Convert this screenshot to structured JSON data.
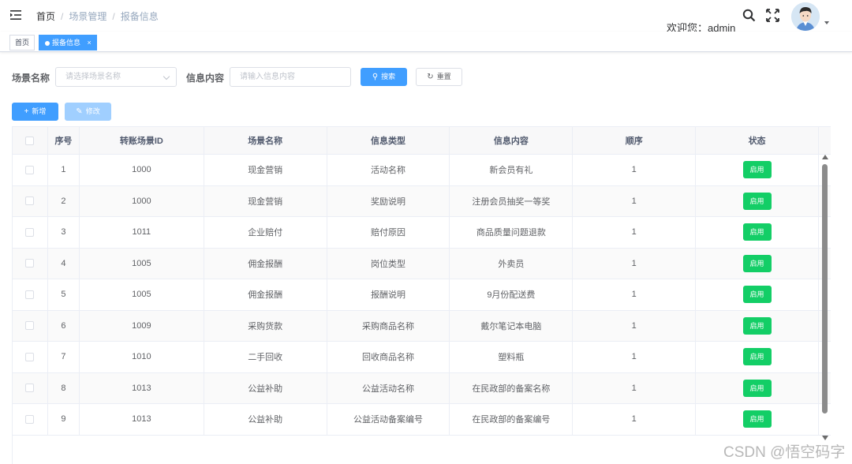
{
  "breadcrumb": [
    "首页",
    "场景管理",
    "报备信息"
  ],
  "user": {
    "welcome": "欢迎您：admin"
  },
  "tags": {
    "home": "首页",
    "active": "报备信息",
    "close": "×"
  },
  "form": {
    "scene_label": "场景名称",
    "scene_placeholder": "请选择场景名称",
    "info_label": "信息内容",
    "info_placeholder": "请输入信息内容",
    "search": "搜索",
    "reset": "重置"
  },
  "toolbar": {
    "add": "新增",
    "edit": "修改"
  },
  "table": {
    "headers": [
      "序号",
      "转账场景ID",
      "场景名称",
      "信息类型",
      "信息内容",
      "顺序",
      "状态"
    ],
    "rows": [
      {
        "no": "1",
        "scene_id": "1000",
        "scene": "现金营销",
        "type": "活动名称",
        "content": "新会员有礼",
        "order": "1",
        "status": "启用"
      },
      {
        "no": "2",
        "scene_id": "1000",
        "scene": "现金营销",
        "type": "奖励说明",
        "content": "注册会员抽奖一等奖",
        "order": "1",
        "status": "启用"
      },
      {
        "no": "3",
        "scene_id": "1011",
        "scene": "企业赔付",
        "type": "赔付原因",
        "content": "商品质量问题退款",
        "order": "1",
        "status": "启用"
      },
      {
        "no": "4",
        "scene_id": "1005",
        "scene": "佣金报酬",
        "type": "岗位类型",
        "content": "外卖员",
        "order": "1",
        "status": "启用"
      },
      {
        "no": "5",
        "scene_id": "1005",
        "scene": "佣金报酬",
        "type": "报酬说明",
        "content": "9月份配送费",
        "order": "1",
        "status": "启用"
      },
      {
        "no": "6",
        "scene_id": "1009",
        "scene": "采购货款",
        "type": "采购商品名称",
        "content": "戴尔笔记本电脑",
        "order": "1",
        "status": "启用"
      },
      {
        "no": "7",
        "scene_id": "1010",
        "scene": "二手回收",
        "type": "回收商品名称",
        "content": "塑料瓶",
        "order": "1",
        "status": "启用"
      },
      {
        "no": "8",
        "scene_id": "1013",
        "scene": "公益补助",
        "type": "公益活动名称",
        "content": "在民政部的备案名称",
        "order": "1",
        "status": "启用"
      },
      {
        "no": "9",
        "scene_id": "1013",
        "scene": "公益补助",
        "type": "公益活动备案编号",
        "content": "在民政部的备案编号",
        "order": "1",
        "status": "启用"
      }
    ]
  },
  "watermark": "CSDN @悟空码字",
  "colors": {
    "primary": "#409eff",
    "success": "#13ce66",
    "disabled": "#a0cfff"
  }
}
